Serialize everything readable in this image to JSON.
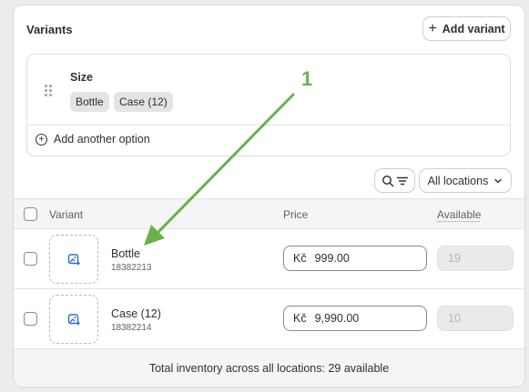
{
  "card": {
    "title": "Variants",
    "add_variant_label": "Add variant"
  },
  "option": {
    "name": "Size",
    "values": [
      "Bottle",
      "Case (12)"
    ],
    "add_another_label": "Add another option"
  },
  "toolbar": {
    "location_select": "All locations"
  },
  "table": {
    "columns": [
      "Variant",
      "Price",
      "Available"
    ],
    "rows": [
      {
        "name": "Bottle",
        "sku": "18382213",
        "currency": "Kč",
        "price": "999.00",
        "available": "19"
      },
      {
        "name": "Case (12)",
        "sku": "18382214",
        "currency": "Kč",
        "price": "9,990.00",
        "available": "10"
      }
    ]
  },
  "footer": {
    "total_text": "Total inventory across all locations: 29 available"
  },
  "annotation": {
    "number": "1",
    "color": "#6ab04c"
  },
  "icons": {
    "add_variant": "plus-icon",
    "drag": "drag-handle-icon",
    "add_option": "circle-plus-icon",
    "search": "search-icon",
    "filter": "filter-icon",
    "dropdown": "chevron-down-icon",
    "thumbnail": "add-image-icon"
  }
}
